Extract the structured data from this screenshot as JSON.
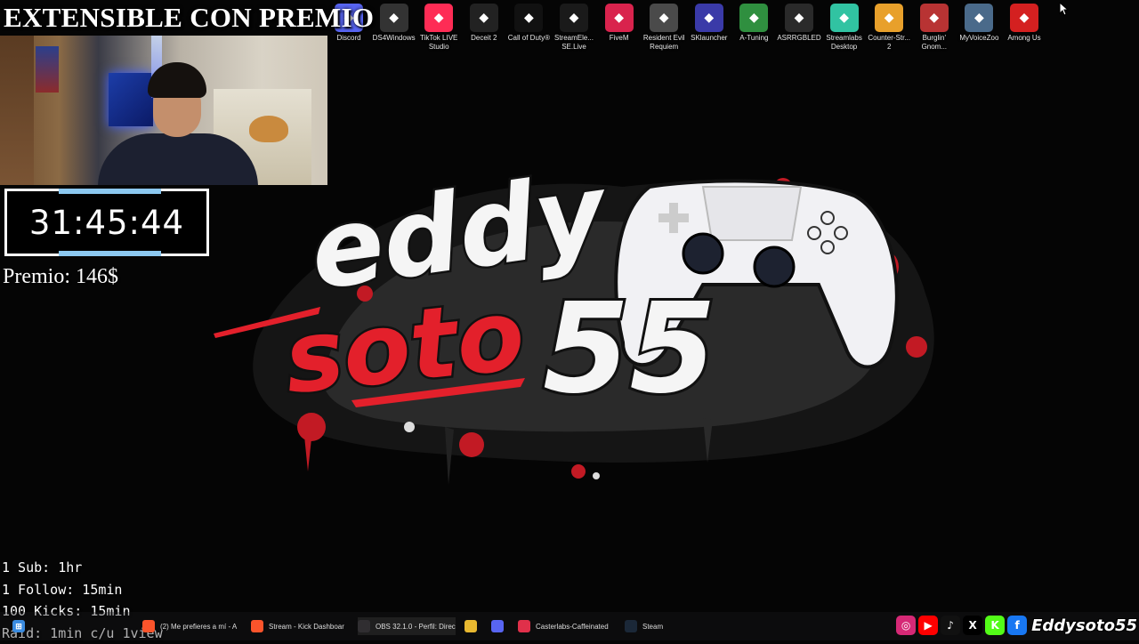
{
  "overlay": {
    "title": "EXTENSIBLE CON PREMIO",
    "timer": "31:45:44",
    "prize": "Premio: 146$",
    "rules": [
      "1 Sub: 1hr",
      "1 Follow: 15min",
      "100 Kicks: 15min",
      "Raid: 1min c/u 1view"
    ]
  },
  "logo": {
    "line1": "eddy",
    "line2": "soto",
    "line3": "55"
  },
  "desktop_icons": [
    {
      "label": "Discord",
      "icon": "discord-icon",
      "color": "#5865f2"
    },
    {
      "label": "DS4Windows",
      "icon": "gamepad-icon",
      "color": "#333333"
    },
    {
      "label": "TikTok LIVE Studio",
      "icon": "tiktok-icon",
      "color": "#fe2c55"
    },
    {
      "label": "Deceit 2",
      "icon": "rabbit-icon",
      "color": "#222222"
    },
    {
      "label": "Call of Duty®",
      "icon": "cod-icon",
      "color": "#111111"
    },
    {
      "label": "StreamEle... SE.Live",
      "icon": "streamelements-icon",
      "color": "#1a1a1a"
    },
    {
      "label": "FiveM",
      "icon": "fivem-icon",
      "color": "#d9234d"
    },
    {
      "label": "Resident Evil Requiem",
      "icon": "re-icon",
      "color": "#4a4a4a"
    },
    {
      "label": "SKlauncher",
      "icon": "cube-icon",
      "color": "#3a3aa8"
    },
    {
      "label": "A-Tuning",
      "icon": "atuning-icon",
      "color": "#2f8f3f"
    },
    {
      "label": "ASRRGBLED",
      "icon": "asrock-icon",
      "color": "#2a2a2a"
    },
    {
      "label": "Streamlabs Desktop",
      "icon": "streamlabs-icon",
      "color": "#31c3a2"
    },
    {
      "label": "Counter-Str... 2",
      "icon": "cs2-icon",
      "color": "#e8a02b"
    },
    {
      "label": "Burglin' Gnom...",
      "icon": "gnome-icon",
      "color": "#b83333"
    },
    {
      "label": "MyVoiceZoo",
      "icon": "bird-icon",
      "color": "#4a6a8a"
    },
    {
      "label": "Among Us",
      "icon": "amongus-icon",
      "color": "#d42020"
    }
  ],
  "taskbar": {
    "items": [
      {
        "label": "(2) Me prefieres a mí - A",
        "icon": "brave-icon",
        "color": "#fb542b"
      },
      {
        "label": "Stream - Kick Dashboar",
        "icon": "brave-icon",
        "color": "#fb542b"
      },
      {
        "label": "OBS 32.1.0 - Perfil: Direc",
        "icon": "obs-icon",
        "color": "#302e31"
      },
      {
        "label": "",
        "icon": "folder-icon",
        "color": "#e8b830"
      },
      {
        "label": "",
        "icon": "discord-icon",
        "color": "#5865f2"
      },
      {
        "label": "Casterlabs-Caffeinated",
        "icon": "casterlabs-icon",
        "color": "#e0304a"
      },
      {
        "label": "Steam",
        "icon": "steam-icon",
        "color": "#1b2838"
      }
    ]
  },
  "socials": {
    "icons": [
      {
        "name": "instagram-icon",
        "color": "#d62976",
        "glyph": "◎"
      },
      {
        "name": "youtube-icon",
        "color": "#ff0000",
        "glyph": "▶"
      },
      {
        "name": "tiktok-icon",
        "color": "#111111",
        "glyph": "♪"
      },
      {
        "name": "x-icon",
        "color": "#000000",
        "glyph": "X"
      },
      {
        "name": "kick-icon",
        "color": "#53fc18",
        "glyph": "K"
      },
      {
        "name": "facebook-icon",
        "color": "#1877f2",
        "glyph": "f"
      }
    ],
    "handle": "Eddysoto55"
  }
}
